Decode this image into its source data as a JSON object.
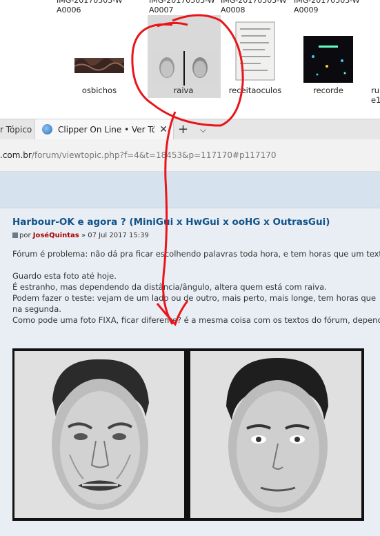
{
  "explorer": {
    "files": [
      {
        "top_name": "",
        "name": "osbichos"
      },
      {
        "top_name": "IMG-20170503-W\nA0007",
        "name": "raiva"
      },
      {
        "top_name": "IMG-20170503-W\nA0008",
        "name": "receitaoculos"
      },
      {
        "top_name": "IMG-20170503-W\nA0009",
        "name": "recorde"
      }
    ],
    "first_top_name": "IMG-20170503-W\nA0006",
    "partial_name": "ru\ne1"
  },
  "tabs": {
    "prev_tab": "r Tópico",
    "active_title": "Clipper On Line • Ver Tópico",
    "close_glyph": "✕",
    "new_tab_glyph": "+",
    "tab_list_glyph": "⌵"
  },
  "address": {
    "domain": ".com.br",
    "path": "/forum/viewtopic.php?f=4&t=18453&p=117170#p117170"
  },
  "post": {
    "title": "Harbour-OK e agora ? (MiniGui x HwGui x ooHG x OutrasGui)",
    "by": "por",
    "author": "JoséQuintas",
    "date": "» 07 Jul 2017 15:39",
    "lines": [
      "Fórum é problema: não dá pra ficar escolhendo palavras toda hora, e tem horas que um texto",
      "",
      "Guardo esta foto até hoje.",
      "É estranho, mas dependendo da distância/ângulo, altera quem está com raiva.",
      "Podem fazer o teste: vejam de um lado ou de outro, mais perto, mais longe, tem horas que",
      "na segunda.",
      "Como pode uma foto FIXA, ficar diferente? é a mesma coisa com os textos do fórum, depende"
    ]
  },
  "colors": {
    "title_blue": "#105289",
    "author_red": "#aa0000",
    "annotation_red": "#e8151b"
  }
}
